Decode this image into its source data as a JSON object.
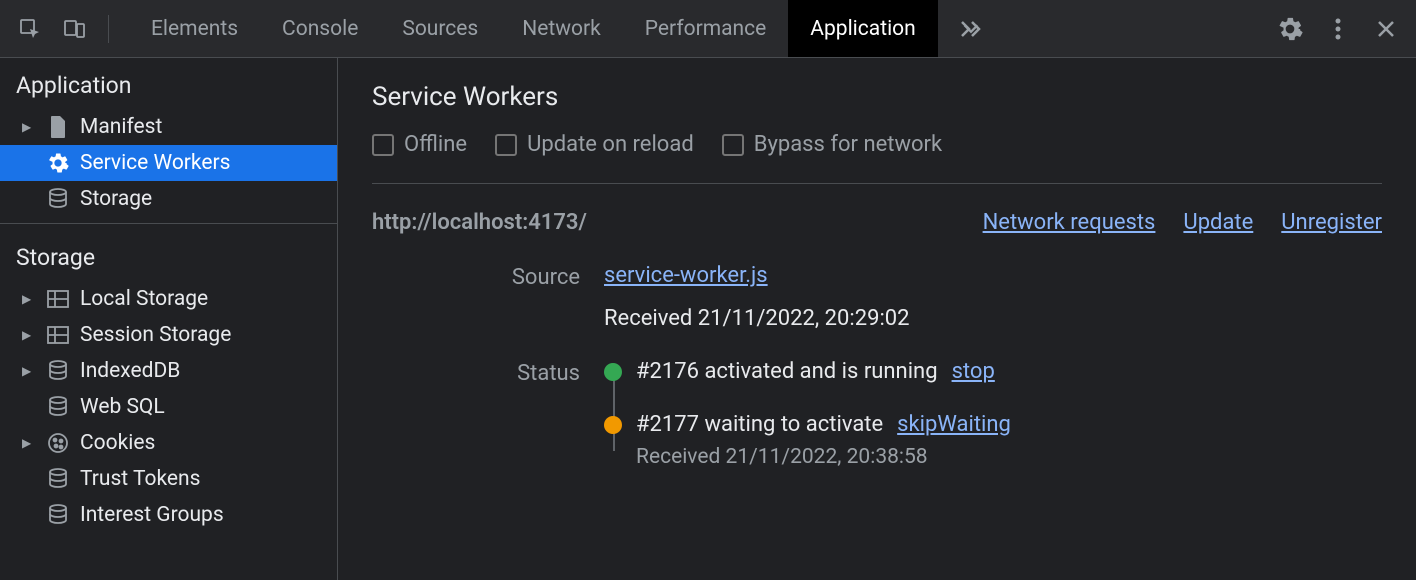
{
  "toolbar": {
    "tabs": {
      "elements": "Elements",
      "console": "Console",
      "sources": "Sources",
      "network": "Network",
      "performance": "Performance",
      "application": "Application"
    }
  },
  "sidebar": {
    "section_application": "Application",
    "items_app": {
      "manifest": "Manifest",
      "service_workers": "Service Workers",
      "storage": "Storage"
    },
    "section_storage": "Storage",
    "items_storage": {
      "local_storage": "Local Storage",
      "session_storage": "Session Storage",
      "indexeddb": "IndexedDB",
      "web_sql": "Web SQL",
      "cookies": "Cookies",
      "trust_tokens": "Trust Tokens",
      "interest_groups": "Interest Groups"
    }
  },
  "content": {
    "title": "Service Workers",
    "checkboxes": {
      "offline": "Offline",
      "update_on_reload": "Update on reload",
      "bypass_for_network": "Bypass for network"
    },
    "origin": "http://localhost:4173/",
    "links": {
      "network_requests": "Network requests",
      "update": "Update",
      "unregister": "Unregister"
    },
    "fields": {
      "source_label": "Source",
      "source_value": "service-worker.js",
      "received": "Received 21/11/2022, 20:29:02",
      "status_label": "Status"
    },
    "status": {
      "activated": "#2176 activated and is running",
      "stop": "stop",
      "waiting": "#2177 waiting to activate",
      "skip_waiting": "skipWaiting",
      "waiting_received": "Received 21/11/2022, 20:38:58"
    }
  }
}
